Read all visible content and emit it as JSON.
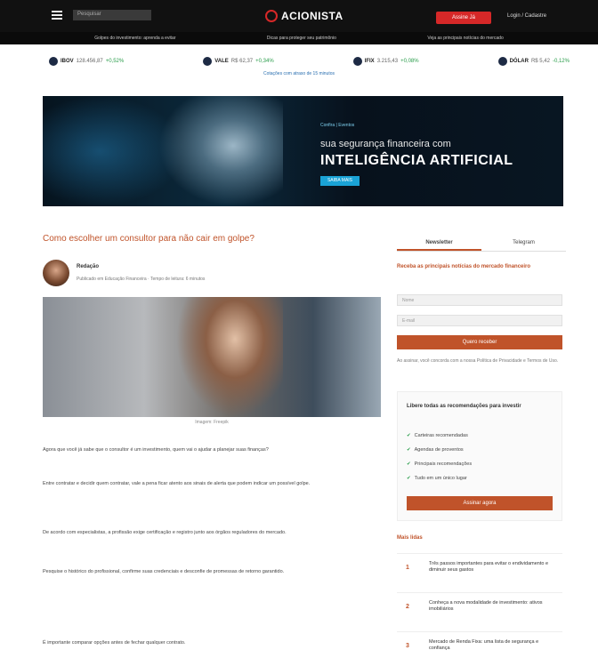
{
  "header": {
    "search_placeholder": "Pesquisar",
    "logo_text": "ACIONISTA",
    "subscribe_label": "Assine Já",
    "login_label": "Login / Cadastre",
    "ticker": [
      "Golpes do investimento: aprenda a evitar",
      "Dicas para proteger seu patrimônio",
      "Veja as principais notícias do mercado"
    ]
  },
  "quotes": {
    "items": [
      {
        "symbol": "IBOV",
        "value": "128.456,87",
        "change": "+0,52%"
      },
      {
        "symbol": "VALE",
        "value": "R$ 62,37",
        "change": "+0,34%"
      },
      {
        "symbol": "IFIX",
        "value": "3.215,43",
        "change": "+0,08%"
      },
      {
        "symbol": "DÓLAR",
        "value": "R$ 5,42",
        "change": "-0,12%"
      }
    ],
    "note": "Cotações com atraso de 15 minutos"
  },
  "banner": {
    "kicker": "Confira  |  Eventos",
    "line1": "sua segurança financeira com",
    "line2": "INTELIGÊNCIA ARTIFICIAL",
    "button": "SAIBA MAIS"
  },
  "article": {
    "headline": "Como escolher um consultor para não cair em golpe?",
    "author_name": "Redação",
    "author_meta": "Publicado em Educação Financeira  ·  Tempo de leitura: 6 minutos",
    "hero_caption": "Imagem: Freepik",
    "paragraphs": [
      "Agora que você já sabe que o consultor é um investimento, quem vai o ajudar a planejar suas finanças?",
      "Entre contratar e decidir quem contratar, vale a pena ficar atento aos sinais de alerta que podem indicar um possível golpe.",
      "De acordo com especialistas, a profissão exige certificação e registro junto aos órgãos reguladores do mercado.",
      "Pesquise o histórico do profissional, confirme suas credenciais e desconfie de promessas de retorno garantido.",
      "É importante comparar opções antes de fechar qualquer contrato."
    ]
  },
  "sidebar": {
    "tabs": [
      "Newsletter",
      "Telegram"
    ],
    "title": "Receba as principais notícias do mercado financeiro",
    "name_placeholder": "Nome",
    "email_placeholder": "E-mail",
    "button": "Quero receber",
    "note": "Ao assinar, você concorda com a nossa Política de Privacidade e Termos de Uso."
  },
  "recommend": {
    "title": "Libere todas as recomendações para investir",
    "items": [
      "Carteiras recomendadas",
      "Agendas de proventos",
      "Principais recomendações",
      "Tudo em um único lugar"
    ],
    "button": "Assinar agora"
  },
  "news": {
    "title": "Mais lidas",
    "items": [
      {
        "num": "1",
        "text": "Três passos importantes para evitar o endividamento e diminuir seus gastos"
      },
      {
        "num": "2",
        "text": "Conheça a nova modalidade de investimento: ativos imobiliários"
      },
      {
        "num": "3",
        "text": "Mercado de Renda Fixa: uma lista de segurança e confiança"
      }
    ]
  }
}
